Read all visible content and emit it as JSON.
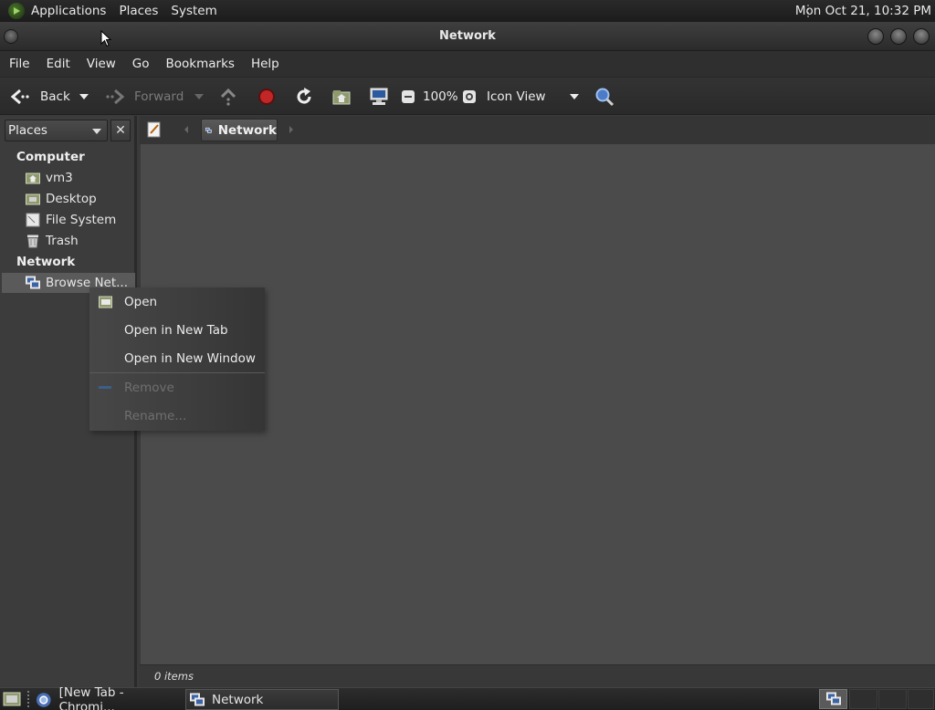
{
  "top_panel": {
    "menus": [
      "Applications",
      "Places",
      "System"
    ],
    "clock": "Mon Oct 21, 10:32 PM"
  },
  "window": {
    "title": "Network"
  },
  "menubar": [
    "File",
    "Edit",
    "View",
    "Go",
    "Bookmarks",
    "Help"
  ],
  "toolbar": {
    "back_label": "Back",
    "forward_label": "Forward",
    "zoom": "100%",
    "view_mode": "Icon View"
  },
  "sidebar": {
    "selector": "Places",
    "computer_heading": "Computer",
    "computer_items": [
      {
        "label": "vm3",
        "icon": "home-folder-icon"
      },
      {
        "label": "Desktop",
        "icon": "desktop-folder-icon"
      },
      {
        "label": "File System",
        "icon": "drive-icon"
      },
      {
        "label": "Trash",
        "icon": "trash-icon"
      }
    ],
    "network_heading": "Network",
    "network_items": [
      {
        "label": "Browse Net...",
        "icon": "network-icon"
      }
    ]
  },
  "location": {
    "current": "Network"
  },
  "context_menu": {
    "open": "Open",
    "open_new_tab": "Open in New Tab",
    "open_new_window": "Open in New Window",
    "remove": "Remove",
    "rename": "Rename..."
  },
  "status": {
    "items": "0 items"
  },
  "taskbar": {
    "tasks": [
      "[New Tab - Chromi...",
      "Network"
    ]
  }
}
